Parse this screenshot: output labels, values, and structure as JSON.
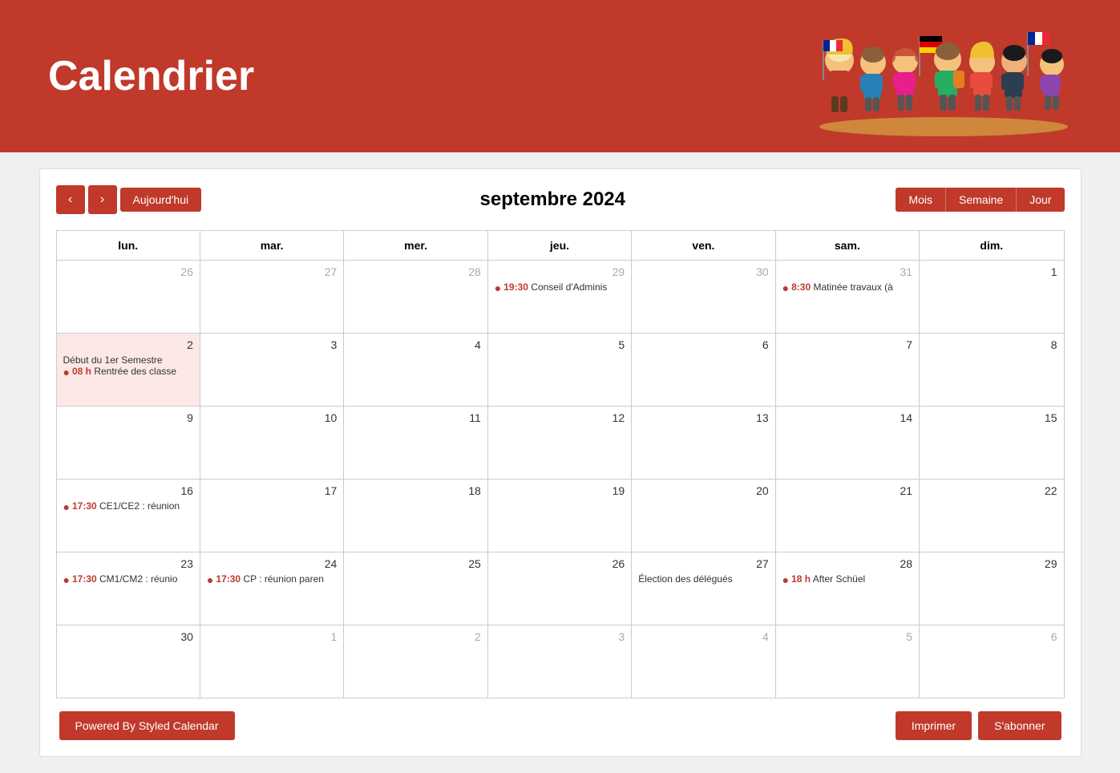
{
  "header": {
    "title": "Calendrier",
    "bg_color": "#c0392b"
  },
  "toolbar": {
    "prev_label": "‹",
    "next_label": "›",
    "today_label": "Aujourd'hui",
    "calendar_title": "septembre 2024",
    "view_month": "Mois",
    "view_week": "Semaine",
    "view_day": "Jour"
  },
  "day_headers": [
    "lun.",
    "mar.",
    "mer.",
    "jeu.",
    "ven.",
    "sam.",
    "dim."
  ],
  "weeks": [
    [
      {
        "num": "26",
        "other": true,
        "highlight": false,
        "events": []
      },
      {
        "num": "27",
        "other": true,
        "highlight": false,
        "events": []
      },
      {
        "num": "28",
        "other": true,
        "highlight": false,
        "events": []
      },
      {
        "num": "29",
        "other": true,
        "highlight": false,
        "events": [
          {
            "time": "19:30",
            "text": "Conseil d'Adminis"
          }
        ]
      },
      {
        "num": "30",
        "other": true,
        "highlight": false,
        "events": []
      },
      {
        "num": "31",
        "other": true,
        "highlight": false,
        "events": [
          {
            "time": "8:30",
            "text": "Matinée travaux (à"
          }
        ]
      },
      {
        "num": "1",
        "other": false,
        "highlight": false,
        "events": []
      }
    ],
    [
      {
        "num": "2",
        "other": false,
        "highlight": true,
        "events": [
          {
            "label": "Début du 1er Semestre"
          },
          {
            "time": "08 h",
            "text": "Rentrée des classe"
          }
        ]
      },
      {
        "num": "3",
        "other": false,
        "highlight": false,
        "events": []
      },
      {
        "num": "4",
        "other": false,
        "highlight": false,
        "events": []
      },
      {
        "num": "5",
        "other": false,
        "highlight": false,
        "events": []
      },
      {
        "num": "6",
        "other": false,
        "highlight": false,
        "events": []
      },
      {
        "num": "7",
        "other": false,
        "highlight": false,
        "events": []
      },
      {
        "num": "8",
        "other": false,
        "highlight": false,
        "events": []
      }
    ],
    [
      {
        "num": "9",
        "other": false,
        "highlight": false,
        "events": []
      },
      {
        "num": "10",
        "other": false,
        "highlight": false,
        "events": []
      },
      {
        "num": "11",
        "other": false,
        "highlight": false,
        "events": []
      },
      {
        "num": "12",
        "other": false,
        "highlight": false,
        "events": []
      },
      {
        "num": "13",
        "other": false,
        "highlight": false,
        "events": []
      },
      {
        "num": "14",
        "other": false,
        "highlight": false,
        "events": []
      },
      {
        "num": "15",
        "other": false,
        "highlight": false,
        "events": []
      }
    ],
    [
      {
        "num": "16",
        "other": false,
        "highlight": false,
        "events": [
          {
            "time": "17:30",
            "text": "CE1/CE2 : réunion"
          }
        ]
      },
      {
        "num": "17",
        "other": false,
        "highlight": false,
        "events": []
      },
      {
        "num": "18",
        "other": false,
        "highlight": false,
        "events": []
      },
      {
        "num": "19",
        "other": false,
        "highlight": false,
        "events": []
      },
      {
        "num": "20",
        "other": false,
        "highlight": false,
        "events": []
      },
      {
        "num": "21",
        "other": false,
        "highlight": false,
        "events": []
      },
      {
        "num": "22",
        "other": false,
        "highlight": false,
        "events": []
      }
    ],
    [
      {
        "num": "23",
        "other": false,
        "highlight": false,
        "events": [
          {
            "time": "17:30",
            "text": "CM1/CM2 : réunio"
          }
        ]
      },
      {
        "num": "24",
        "other": false,
        "highlight": false,
        "events": [
          {
            "time": "17:30",
            "text": "CP : réunion paren"
          }
        ]
      },
      {
        "num": "25",
        "other": false,
        "highlight": false,
        "events": []
      },
      {
        "num": "26",
        "other": false,
        "highlight": false,
        "events": []
      },
      {
        "num": "27",
        "other": false,
        "highlight": false,
        "events": [
          {
            "label": "Élection des délégués"
          }
        ]
      },
      {
        "num": "28",
        "other": false,
        "highlight": false,
        "events": [
          {
            "time": "18 h",
            "text": "After Schüel"
          }
        ]
      },
      {
        "num": "29",
        "other": false,
        "highlight": false,
        "events": []
      }
    ],
    [
      {
        "num": "30",
        "other": false,
        "highlight": false,
        "events": []
      },
      {
        "num": "1",
        "other": true,
        "highlight": false,
        "events": []
      },
      {
        "num": "2",
        "other": true,
        "highlight": false,
        "events": []
      },
      {
        "num": "3",
        "other": true,
        "highlight": false,
        "events": []
      },
      {
        "num": "4",
        "other": true,
        "highlight": false,
        "events": []
      },
      {
        "num": "5",
        "other": true,
        "highlight": false,
        "events": []
      },
      {
        "num": "6",
        "other": true,
        "highlight": false,
        "events": []
      }
    ]
  ],
  "footer": {
    "powered_label": "Powered By Styled Calendar",
    "print_label": "Imprimer",
    "subscribe_label": "S'abonner"
  }
}
